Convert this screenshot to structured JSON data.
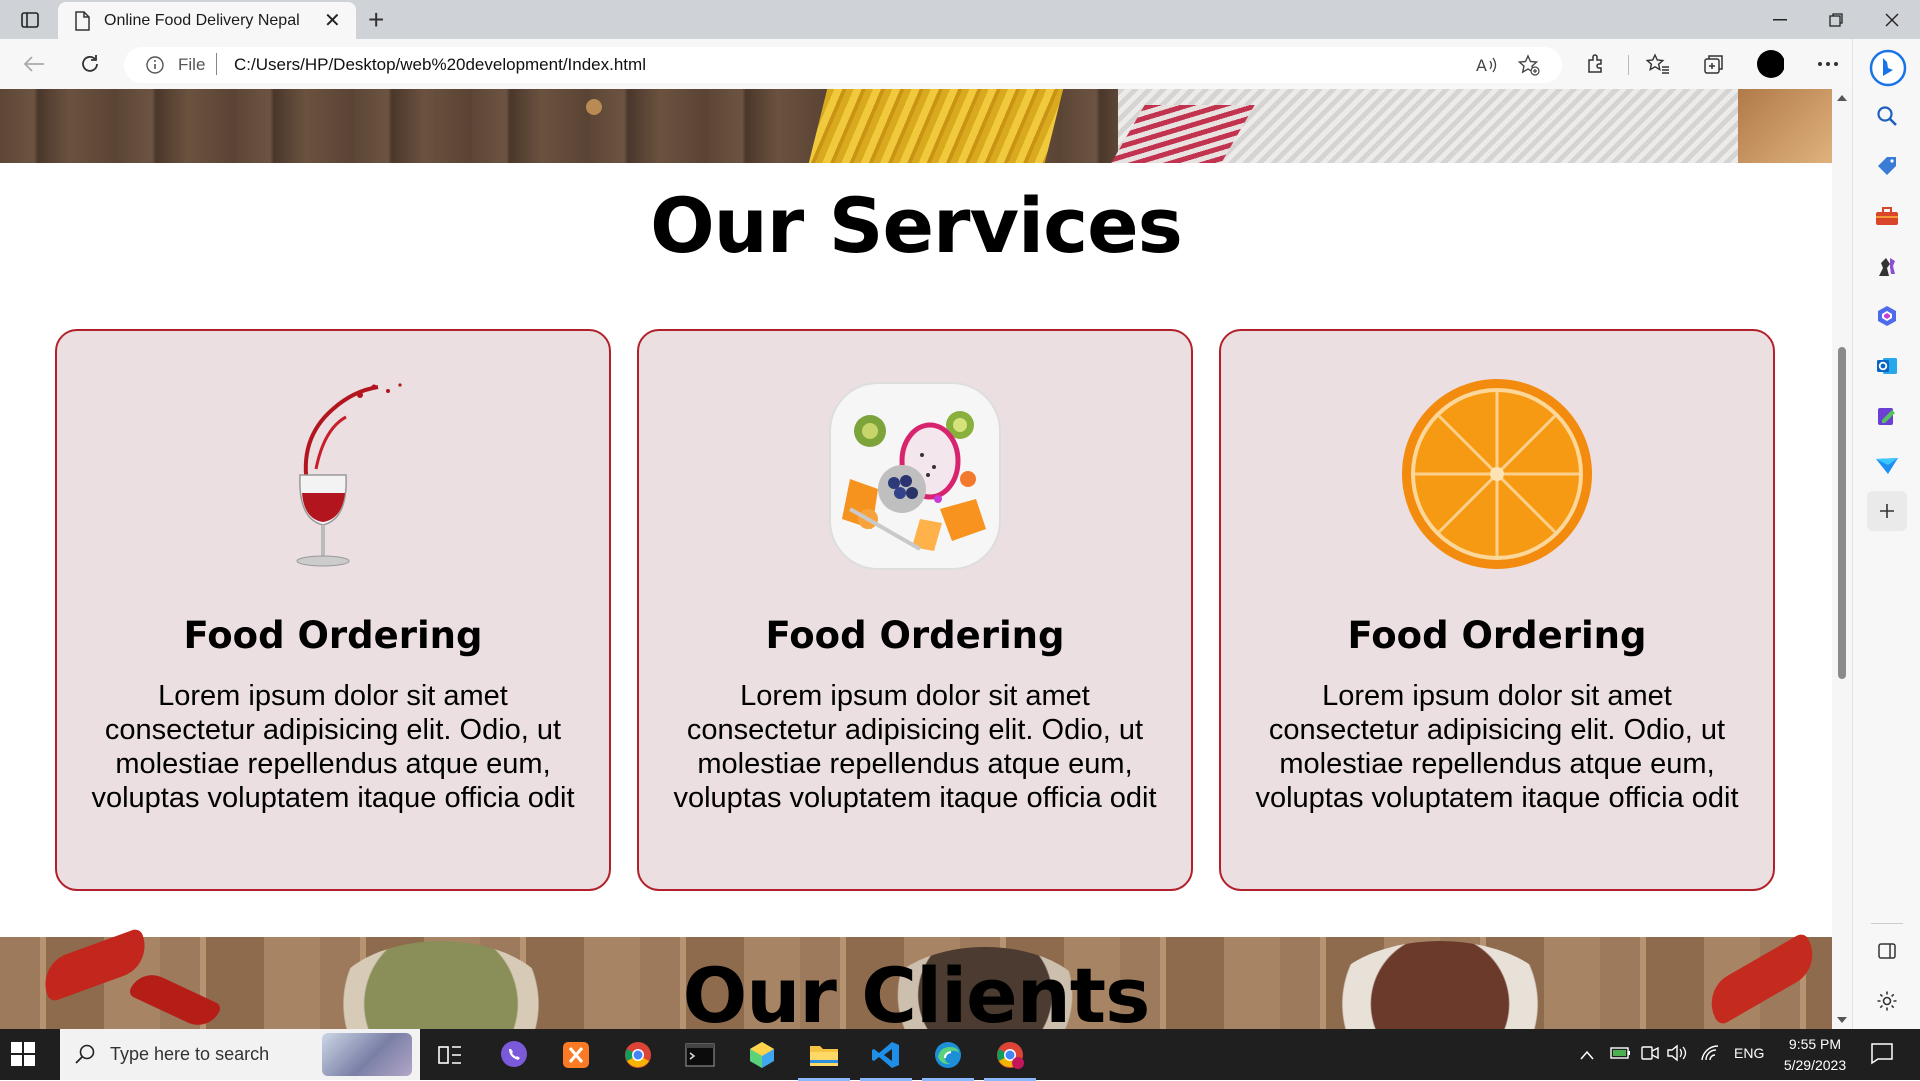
{
  "browser": {
    "tab_title": "Online Food Delivery Nepal",
    "close_glyph": "✕",
    "new_tab_glyph": "+",
    "address_scheme": "File",
    "address_url": "C:/Users/HP/Desktop/web%20development/Index.html"
  },
  "page": {
    "services_title": "Our Services",
    "services": [
      {
        "image": "wine-glass-splash",
        "title": "Food Ordering",
        "text": "Lorem ipsum dolor sit amet consectetur adipisicing elit. Odio, ut molestiae repellendus atque eum, voluptas voluptatem itaque officia odit"
      },
      {
        "image": "fruit-platter",
        "title": "Food Ordering",
        "text": "Lorem ipsum dolor sit amet consectetur adipisicing elit. Odio, ut molestiae repellendus atque eum, voluptas voluptatem itaque officia odit"
      },
      {
        "image": "orange-slice",
        "title": "Food Ordering",
        "text": "Lorem ipsum dolor sit amet consectetur adipisicing elit. Odio, ut molestiae repellendus atque eum, voluptas voluptatem itaque officia odit"
      }
    ],
    "clients_title": "Our Clients"
  },
  "taskbar": {
    "search_placeholder": "Type here to search",
    "language": "ENG",
    "time": "9:55 PM",
    "date": "5/29/2023"
  },
  "colors": {
    "card_bg": "#ebdfe1",
    "card_border": "#b2202b",
    "taskbar_bg": "#1f1f1f"
  }
}
